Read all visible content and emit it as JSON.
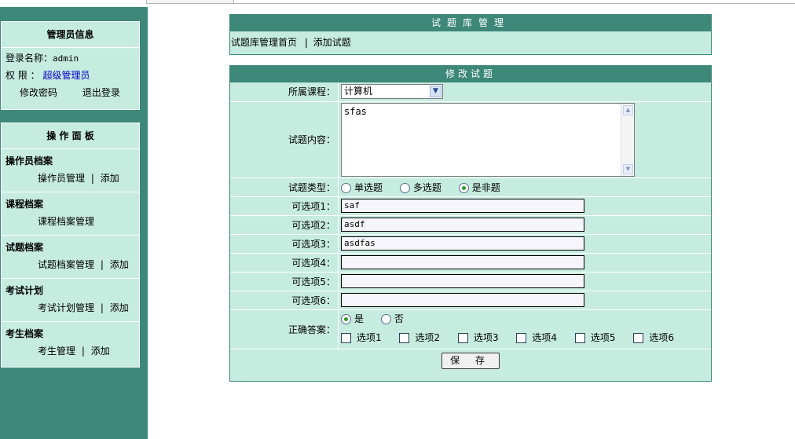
{
  "admin": {
    "title": "管理员信息",
    "login_label": "登录名称：",
    "login_value": "admin",
    "perm_label": "权 限 ：",
    "perm_value": "超级管理员",
    "change_password": "修改密码",
    "logout": "退出登录"
  },
  "panel": {
    "title": "操 作 面 板",
    "sections": [
      {
        "heading": "操作员档案",
        "link1": "操作员管理",
        "sep": "|",
        "link2": "添加"
      },
      {
        "heading": "课程档案",
        "link1": "课程档案管理"
      },
      {
        "heading": "试题档案",
        "link1": "试题档案管理",
        "sep": "|",
        "link2": "添加"
      },
      {
        "heading": "考试计划",
        "link1": "考试计划管理",
        "sep": "|",
        "link2": "添加"
      },
      {
        "heading": "考生档案",
        "link1": "考生管理",
        "sep": "|",
        "link2": "添加"
      }
    ]
  },
  "library": {
    "title": "试题库管理",
    "nav_home": "试题库管理首页",
    "nav_sep": "|",
    "nav_add": "添加试题"
  },
  "form": {
    "title": "修改试题",
    "course_label": "所属课程：",
    "course_value": "计算机",
    "content_label": "试题内容：",
    "content_value": "sfas",
    "type_label": "试题类型：",
    "types": [
      "单选题",
      "多选题",
      "是非题"
    ],
    "type_selected": "是非题",
    "options": [
      {
        "label": "可选项1：",
        "value": "saf"
      },
      {
        "label": "可选项2：",
        "value": "asdf"
      },
      {
        "label": "可选项3：",
        "value": "asdfas"
      },
      {
        "label": "可选项4：",
        "value": ""
      },
      {
        "label": "可选项5：",
        "value": ""
      },
      {
        "label": "可选项6：",
        "value": ""
      }
    ],
    "answer_label": "正确答案：",
    "answer_yes": "是",
    "answer_no": "否",
    "answer_selected": "是",
    "answer_checks": [
      "选项1",
      "选项2",
      "选项3",
      "选项4",
      "选项5",
      "选项6"
    ],
    "save": "保 存"
  },
  "colors": {
    "accent": "#3d8878",
    "panel_bg": "#c6ebdf",
    "link": "#0000cc"
  }
}
